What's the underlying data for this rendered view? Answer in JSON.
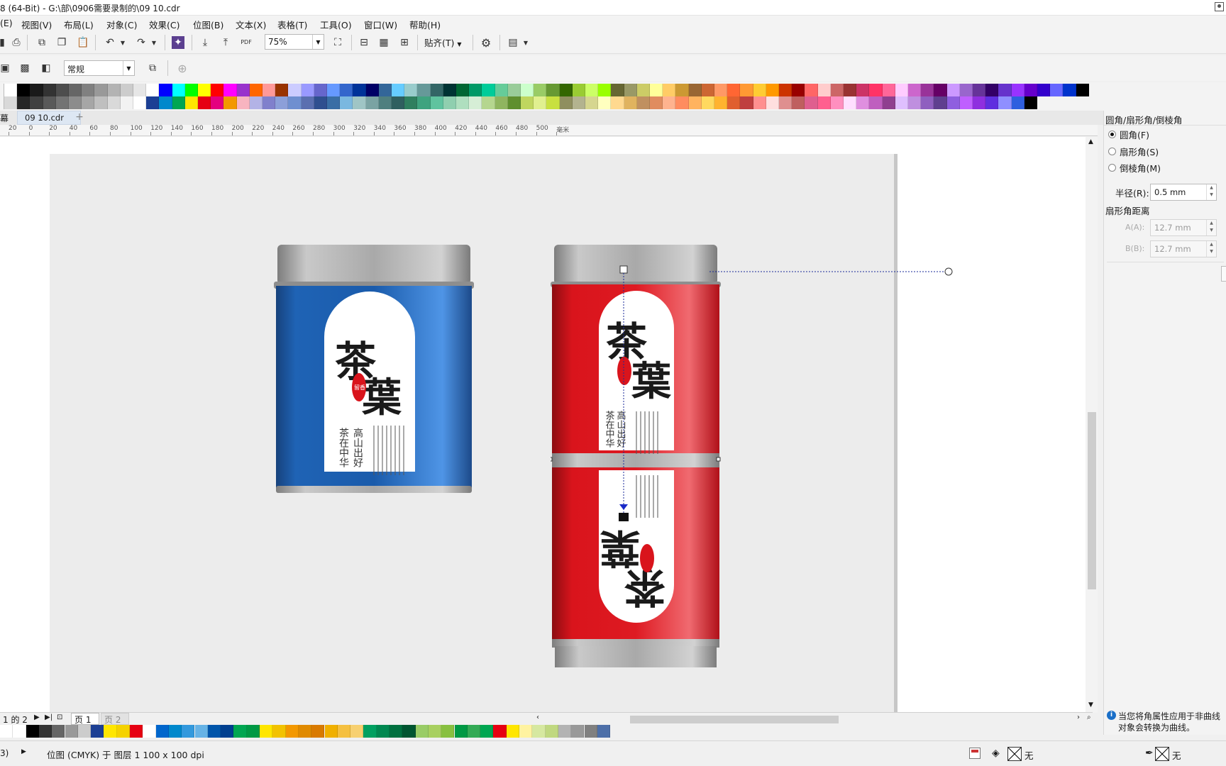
{
  "title_bar": {
    "title": "8 (64-Bit) - G:\\部\\0906需要录制的\\09 10.cdr"
  },
  "menu": [
    "(E)",
    "视图(V)",
    "布局(L)",
    "对象(C)",
    "效果(C)",
    "位图(B)",
    "文本(X)",
    "表格(T)",
    "工具(O)",
    "窗口(W)",
    "帮助(H)"
  ],
  "toolbar": {
    "zoom": "75%",
    "snap_label": "贴齐(T)",
    "pdf_label": "PDF",
    "style_value": "常规"
  },
  "document": {
    "left_tab": "幕",
    "tab_name": "09 10.cdr",
    "ruler_numbers": [
      "20",
      "0",
      "20",
      "40",
      "60",
      "80",
      "100",
      "120",
      "140",
      "160",
      "180",
      "200",
      "220",
      "240",
      "260",
      "280",
      "300",
      "320",
      "340",
      "360",
      "380",
      "400",
      "420",
      "440",
      "460",
      "480",
      "500",
      "毫米"
    ]
  },
  "artwork": {
    "title_chars": [
      "茶",
      "葉"
    ],
    "seal_text": "留香",
    "poem_lines": [
      "高山出好",
      "茶在中华"
    ]
  },
  "panel": {
    "title": "圆角/扇形角/倒棱角",
    "options": [
      {
        "label": "圆角(F)",
        "selected": true
      },
      {
        "label": "扇形角(S)",
        "selected": false
      },
      {
        "label": "倒棱角(M)",
        "selected": false
      }
    ],
    "radius_label": "半径(R):",
    "radius_value": "0.5 mm",
    "distance_title": "扇形角距离",
    "a_label": "A(A):",
    "a_value": "12.7 mm",
    "b_label": "B(B):",
    "b_value": "12.7 mm",
    "info_text_1": "当您将角属性应用于非曲线",
    "info_text_2": "对象会转换为曲线。"
  },
  "page_nav": {
    "counter": "1 的 2",
    "pages": [
      "页 1",
      "页 2"
    ]
  },
  "status": {
    "left_marker": "3)",
    "info": "位图 (CMYK) 于 图层 1 100 x 100 dpi",
    "fill_none": "无",
    "outline_none": "无"
  },
  "colors": {
    "accent_blue": "#1e5fae",
    "can_red": "#d9141c",
    "palette_top": [
      "#ffffff",
      "#000000",
      "#1a1a1a",
      "#333333",
      "#4d4d4d",
      "#666666",
      "#808080",
      "#999999",
      "#b3b3b3",
      "#cccccc",
      "#e6e6e6",
      "#ffffff",
      "#0000ff",
      "#00ffff",
      "#00ff00",
      "#ffff00",
      "#ff0000",
      "#ff00ff",
      "#9933cc",
      "#ff6600",
      "#ff9999",
      "#993300",
      "#ccccff",
      "#9999ff",
      "#6666cc",
      "#6699ff",
      "#3366cc",
      "#003399",
      "#000066",
      "#336699",
      "#66ccff",
      "#99cccc",
      "#669999",
      "#336666",
      "#003333",
      "#006633",
      "#009966",
      "#00cc99",
      "#66cc99",
      "#99cc99",
      "#ccffcc",
      "#99cc66",
      "#669933",
      "#336600",
      "#99cc33",
      "#ccff66",
      "#99ff00",
      "#666633",
      "#999966",
      "#cccc66",
      "#ffff99",
      "#ffcc66",
      "#cc9933",
      "#996633",
      "#cc6633",
      "#ff9966",
      "#ff6633",
      "#ff9933",
      "#ffcc33",
      "#ff9900",
      "#cc3300",
      "#990000",
      "#ff6666",
      "#ffcccc",
      "#cc6666",
      "#993333",
      "#cc3366",
      "#ff3366",
      "#ff6699",
      "#ffccff",
      "#cc66cc",
      "#993399",
      "#660066",
      "#cc99ff",
      "#9966cc",
      "#663399",
      "#330066",
      "#6633cc",
      "#9933ff",
      "#6600cc",
      "#3300cc",
      "#6666ff",
      "#0033cc",
      "#000000"
    ],
    "palette_bottom": [
      "#d9d9d9",
      "#262626",
      "#404040",
      "#595959",
      "#737373",
      "#8c8c8c",
      "#a6a6a6",
      "#bfbfbf",
      "#d9d9d9",
      "#f2f2f2",
      "#ffffff",
      "#1c3f94",
      "#0088cc",
      "#00a651",
      "#ffe600",
      "#e60012",
      "#e4007f",
      "#f39800",
      "#f8b4c0",
      "#b3b3e6",
      "#8080cc",
      "#8c9fd9",
      "#6f8fd0",
      "#5a6fb0",
      "#2f4f8f",
      "#3a6ea5",
      "#7ab8e0",
      "#9fc5c5",
      "#7aa3a3",
      "#4f7f7f",
      "#2f5f5f",
      "#2f7f5f",
      "#3fa37f",
      "#5fc39f",
      "#8fcfaf",
      "#afdfbf",
      "#d6eed6",
      "#b5d68f",
      "#8fb55f",
      "#5f8f2f",
      "#bfd65f",
      "#e0f08f",
      "#c8e040",
      "#8f8f5f",
      "#b3b38f",
      "#d6d68f",
      "#ffffbf",
      "#ffd98f",
      "#e0b35f",
      "#c09060",
      "#e08c5f",
      "#ffb38f",
      "#ff8c5f",
      "#ffb35f",
      "#ffd95f",
      "#ffb32f",
      "#e05f2f",
      "#bf3f3f",
      "#ff8f8f",
      "#ffdfdf",
      "#df8f8f",
      "#bf5f5f",
      "#df5f8f",
      "#ff5f8f",
      "#ff8fbf",
      "#ffdfff",
      "#df8fdf",
      "#bf5fbf",
      "#8f3f8f",
      "#dfbfff",
      "#bf8fdf",
      "#8f5fbf",
      "#5f3f8f",
      "#8f5fdf",
      "#bf5fff",
      "#8f2fdf",
      "#5f2fdf",
      "#8f8fff",
      "#2f5fdf",
      "#000000"
    ],
    "palette_row2": [
      "#ffffff",
      "#ffffff",
      "#000000",
      "#333333",
      "#666666",
      "#999999",
      "#cccccc",
      "#1c3f94",
      "#ffe600",
      "#f5d200",
      "#e60012",
      "#ffffff",
      "#0066cc",
      "#0088cc",
      "#3399dd",
      "#66b3e6",
      "#0055aa",
      "#003f8f",
      "#00a651",
      "#009944",
      "#ffe600",
      "#f2c200",
      "#f39800",
      "#e08a00",
      "#d97a00",
      "#f0b000",
      "#f5c040",
      "#f7d070",
      "#00a060",
      "#008850",
      "#00703f",
      "#005530",
      "#99cc66",
      "#a8d060",
      "#88c040",
      "#009944",
      "#33aa55",
      "#00a651",
      "#e60012",
      "#ffe600",
      "#fff3a0",
      "#d6e8a0",
      "#c0d880",
      "#b3b3b3",
      "#999999",
      "#808080",
      "#4d6fa8"
    ]
  }
}
